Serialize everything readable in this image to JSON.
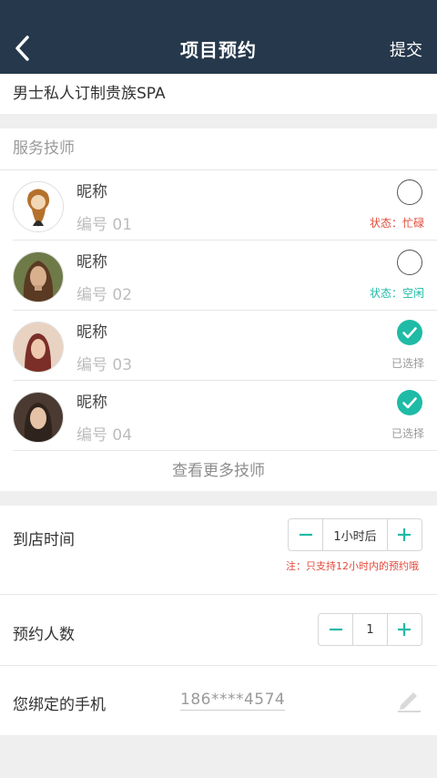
{
  "header": {
    "title": "项目预约",
    "submit_label": "提交"
  },
  "product_name": "男士私人订制贵族SPA",
  "technicians": {
    "section_title": "服务技师",
    "items": [
      {
        "name": "昵称",
        "number": "编号 01",
        "status": "状态：忙碌",
        "selected": false,
        "status_color": "#e24a3b"
      },
      {
        "name": "昵称",
        "number": "编号 02",
        "status": "状态：空闲",
        "selected": false,
        "status_color": "#1fbba6"
      },
      {
        "name": "昵称",
        "number": "编号 03",
        "status": "已选择",
        "selected": true,
        "status_color": "#9a9a9a"
      },
      {
        "name": "昵称",
        "number": "编号 04",
        "status": "已选择",
        "selected": true,
        "status_color": "#9a9a9a"
      }
    ],
    "more_label": "查看更多技师"
  },
  "arrival": {
    "label": "到店时间",
    "value": "1小时后",
    "note": "注：只支持12小时内的预约哦"
  },
  "people": {
    "label": "预约人数",
    "value": "1"
  },
  "phone": {
    "label": "您绑定的手机",
    "value": "186****4574"
  },
  "colors": {
    "nav_bg": "#26384b",
    "accent": "#1fbba6",
    "busy": "#e24a3b"
  }
}
